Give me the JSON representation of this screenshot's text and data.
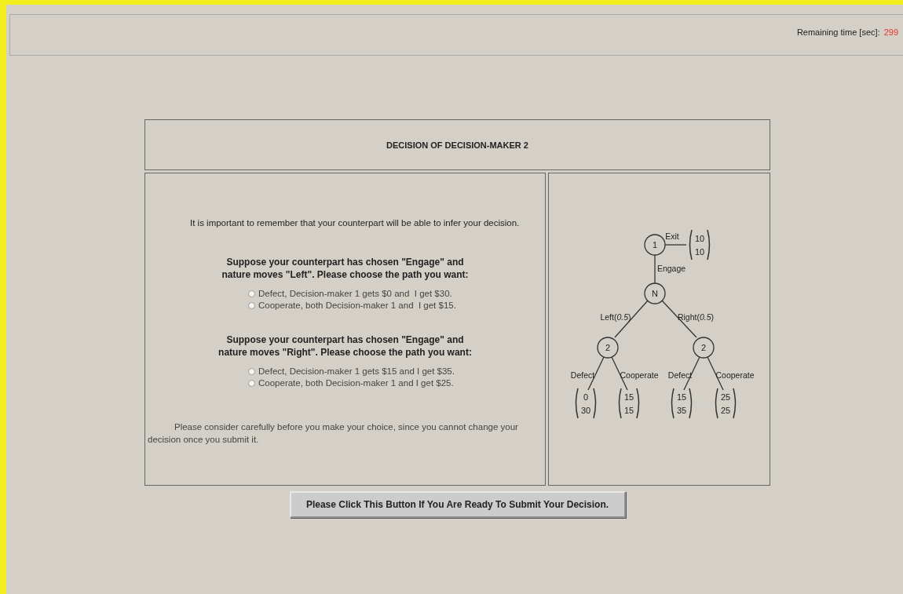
{
  "timer": {
    "label": "Remaining time [sec]:",
    "value": "299"
  },
  "title": "DECISION OF DECISION-MAKER 2",
  "intro": "It is important to remember that your counterpart will be able to infer your decision.",
  "questions": [
    {
      "prompt_lines": [
        "Suppose your counterpart has chosen \"Engage\" and",
        "nature moves \"Left\". Please choose the path you want:"
      ],
      "options": [
        {
          "label": "Defect, Decision-maker 1 gets $0 and  I get $30.",
          "selected": false
        },
        {
          "label": "Cooperate, both Decision-maker 1 and  I get $15.",
          "selected": false
        }
      ]
    },
    {
      "prompt_lines": [
        "Suppose your counterpart has chosen \"Engage\" and",
        "nature moves \"Right\". Please choose the path you want:"
      ],
      "options": [
        {
          "label": "Defect, Decision-maker 1 gets $15 and I get $35.",
          "selected": false
        },
        {
          "label": "Cooperate, both Decision-maker 1 and I get $25.",
          "selected": false
        }
      ]
    }
  ],
  "closing": "Please consider carefully before you make your choice, since you cannot change your decision once you submit it.",
  "tree": {
    "nodes": [
      "1",
      "N",
      "2",
      "2"
    ],
    "branches": [
      "Exit",
      "Engage",
      "Left(*0.5*)",
      "Right(*0.5*)",
      "Defect",
      "Cooperate",
      "Defect",
      "Cooperate"
    ],
    "payoffs": [
      [
        "10",
        "10"
      ],
      [
        "0",
        "30"
      ],
      [
        "15",
        "15"
      ],
      [
        "15",
        "35"
      ],
      [
        "25",
        "25"
      ]
    ]
  },
  "submit_button": "Please Click This Button If You Are Ready To Submit Your Decision."
}
